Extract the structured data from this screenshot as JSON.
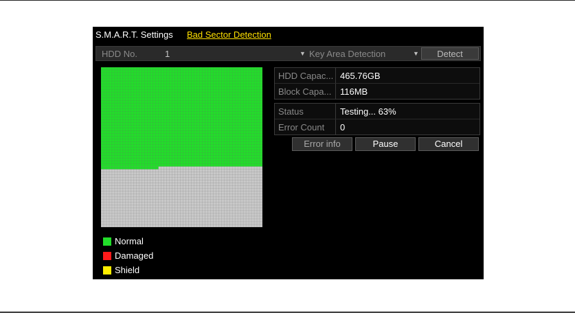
{
  "tabs": [
    {
      "label": "S.M.A.R.T. Settings",
      "active": false
    },
    {
      "label": "Bad Sector Detection",
      "active": true
    }
  ],
  "header": {
    "hdd_label": "HDD No.",
    "hdd_value": "1",
    "mode_value": "Key Area Detection",
    "detect_label": "Detect"
  },
  "capacity": [
    {
      "label": "HDD Capac...",
      "value": "465.76GB"
    },
    {
      "label": "Block Capa...",
      "value": "116MB"
    }
  ],
  "status": [
    {
      "label": "Status",
      "value": "Testing... 63%"
    },
    {
      "label": "Error Count",
      "value": "0"
    }
  ],
  "buttons": {
    "error_info": "Error info",
    "pause": "Pause",
    "cancel": "Cancel"
  },
  "progress": {
    "percent": 63
  },
  "block_map": {
    "columns": 59,
    "rows": 58,
    "normal_blocks": 2145
  },
  "legend": [
    {
      "label": "Normal",
      "color": "#22dd2a"
    },
    {
      "label": "Damaged",
      "color": "#ff1a1a"
    },
    {
      "label": "Shield",
      "color": "#ffee00"
    }
  ],
  "colors": {
    "normal": "#22dd2a",
    "unchecked": "#c9c9c9",
    "grid_line": "#6d6d6d",
    "active_tab": "#ffe100"
  }
}
